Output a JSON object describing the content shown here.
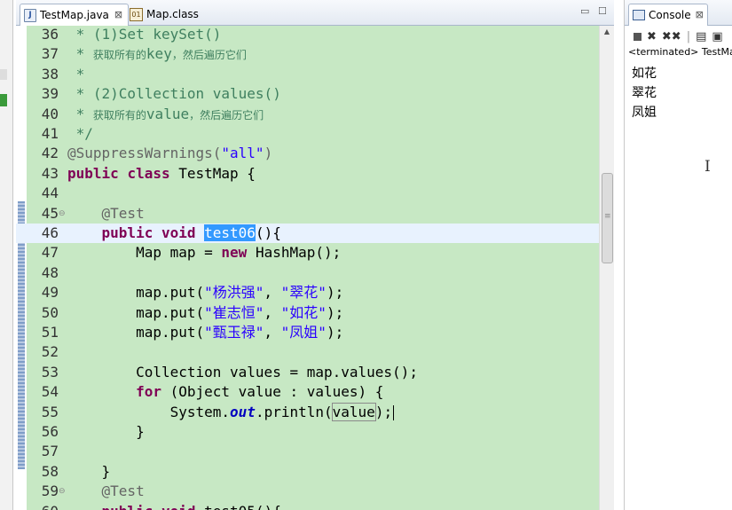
{
  "editor": {
    "tabs": [
      {
        "label": "TestMap.java",
        "close": "⊠",
        "icon": "java-file-icon"
      },
      {
        "label": "Map.class",
        "icon": "class-file-icon"
      }
    ],
    "window_controls": {
      "minimize": "▭",
      "maximize": "☐"
    },
    "lines": [
      {
        "n": "36",
        "parts": [
          [
            "c-comment",
            " * (1)Set keySet()"
          ]
        ]
      },
      {
        "n": "37",
        "parts": [
          [
            "c-comment",
            " * "
          ],
          [
            "c-comment c-cn",
            "获取所有的"
          ],
          [
            "c-comment",
            "key"
          ],
          [
            "c-comment c-cn",
            "，然后遍历它们"
          ]
        ]
      },
      {
        "n": "38",
        "parts": [
          [
            "c-comment",
            " *"
          ]
        ]
      },
      {
        "n": "39",
        "parts": [
          [
            "c-comment",
            " * (2)Collection values()"
          ]
        ]
      },
      {
        "n": "40",
        "parts": [
          [
            "c-comment",
            " * "
          ],
          [
            "c-comment c-cn",
            "获取所有的"
          ],
          [
            "c-comment",
            "value"
          ],
          [
            "c-comment c-cn",
            "，然后遍历它们"
          ]
        ]
      },
      {
        "n": "41",
        "parts": [
          [
            "c-comment",
            " */"
          ]
        ]
      },
      {
        "n": "42",
        "parts": [
          [
            "c-ann",
            "@SuppressWarnings("
          ],
          [
            "c-str",
            "\"all\""
          ],
          [
            "c-ann",
            ")"
          ]
        ]
      },
      {
        "n": "43",
        "parts": [
          [
            "c-kw",
            "public"
          ],
          [
            "",
            " "
          ],
          [
            "c-kw",
            "class"
          ],
          [
            "",
            " TestMap {"
          ]
        ]
      },
      {
        "n": "44",
        "parts": []
      },
      {
        "n": "45",
        "fold": "⊖",
        "parts": [
          [
            "c-ann",
            "    @Test"
          ]
        ]
      },
      {
        "n": "46",
        "current": true,
        "parts": [
          [
            "",
            "    "
          ],
          [
            "c-kw",
            "public"
          ],
          [
            "",
            " "
          ],
          [
            "c-kw",
            "void"
          ],
          [
            "",
            " "
          ],
          [
            "c-sel",
            "test06"
          ],
          [
            "",
            "(){"
          ]
        ]
      },
      {
        "n": "47",
        "parts": [
          [
            "",
            "        Map "
          ],
          [
            "",
            "map"
          ],
          [
            "",
            " = "
          ],
          [
            "c-kw",
            "new"
          ],
          [
            "",
            " HashMap();"
          ]
        ]
      },
      {
        "n": "48",
        "parts": []
      },
      {
        "n": "49",
        "parts": [
          [
            "",
            "        map.put("
          ],
          [
            "c-str",
            "\"杨洪强\""
          ],
          [
            "",
            ", "
          ],
          [
            "c-str",
            "\"翠花\""
          ],
          [
            "",
            ");"
          ]
        ]
      },
      {
        "n": "50",
        "parts": [
          [
            "",
            "        map.put("
          ],
          [
            "c-str",
            "\"崔志恒\""
          ],
          [
            "",
            ", "
          ],
          [
            "c-str",
            "\"如花\""
          ],
          [
            "",
            ");"
          ]
        ]
      },
      {
        "n": "51",
        "parts": [
          [
            "",
            "        map.put("
          ],
          [
            "c-str",
            "\"甄玉禄\""
          ],
          [
            "",
            ", "
          ],
          [
            "c-str",
            "\"凤姐\""
          ],
          [
            "",
            ");"
          ]
        ]
      },
      {
        "n": "52",
        "parts": []
      },
      {
        "n": "53",
        "parts": [
          [
            "",
            "        Collection values = map.values();"
          ]
        ]
      },
      {
        "n": "54",
        "parts": [
          [
            "",
            "        "
          ],
          [
            "c-kw",
            "for"
          ],
          [
            "",
            " (Object value : values) {"
          ]
        ]
      },
      {
        "n": "55",
        "caret": true,
        "parts": [
          [
            "",
            "            System."
          ],
          [
            "c-static",
            "out"
          ],
          [
            "",
            ".println("
          ],
          [
            "c-box",
            "value"
          ],
          [
            "",
            ");"
          ]
        ]
      },
      {
        "n": "56",
        "parts": [
          [
            "",
            "        }"
          ]
        ]
      },
      {
        "n": "57",
        "parts": []
      },
      {
        "n": "58",
        "parts": [
          [
            "",
            "    }"
          ]
        ]
      },
      {
        "n": "59",
        "fold": "⊖",
        "parts": [
          [
            "c-ann",
            "    @Test"
          ]
        ]
      },
      {
        "n": "60",
        "parts": [
          [
            "",
            "    "
          ],
          [
            "c-kw",
            "public"
          ],
          [
            "",
            " "
          ],
          [
            "c-kw",
            "void"
          ],
          [
            "",
            " test05(){"
          ]
        ]
      }
    ]
  },
  "console": {
    "tab_label": "Console",
    "tab_close": "⊠",
    "toolbar": {
      "stop": "■",
      "remove": "✖",
      "remove_all": "✖✖",
      "clear": "▤",
      "pin": "▣"
    },
    "status": "<terminated> TestMap",
    "output": [
      "如花",
      "翠花",
      "凤姐"
    ]
  },
  "colors": {
    "code_background": "#c7e8c4",
    "keyword": "#7f0055",
    "string": "#2a00ff",
    "comment": "#3f7f5f",
    "selection": "#3399ff",
    "current_line": "#e8f2fe"
  }
}
